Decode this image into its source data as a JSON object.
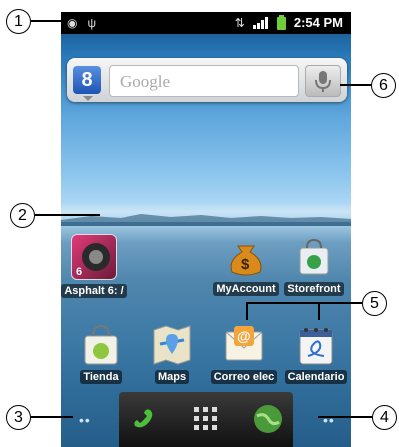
{
  "status_bar": {
    "time": "2:54 PM"
  },
  "search_widget": {
    "placeholder": "Google",
    "logo_letter": "8"
  },
  "home_row1": [
    {
      "label": "Asphalt 6: /",
      "icon": "asphalt-game-icon"
    },
    {
      "label": "MyAccount",
      "icon": "money-bag-icon"
    },
    {
      "label": "Storefront",
      "icon": "storefront-bag-icon"
    }
  ],
  "home_row2": [
    {
      "label": "Tienda",
      "icon": "market-bag-icon"
    },
    {
      "label": "Maps",
      "icon": "map-icon"
    },
    {
      "label": "Correo elec",
      "icon": "email-envelope-icon"
    },
    {
      "label": "Calendario",
      "icon": "calendar-icon"
    }
  ],
  "dock": {
    "left_dots": "••",
    "right_dots": "••"
  },
  "callouts": [
    "1",
    "2",
    "3",
    "4",
    "5",
    "6"
  ],
  "colors": {
    "status_bar": "#000000",
    "label_bg": "rgba(0,0,0,0.55)",
    "sky": "#5ea6dc",
    "water": "#3e7aa6"
  }
}
